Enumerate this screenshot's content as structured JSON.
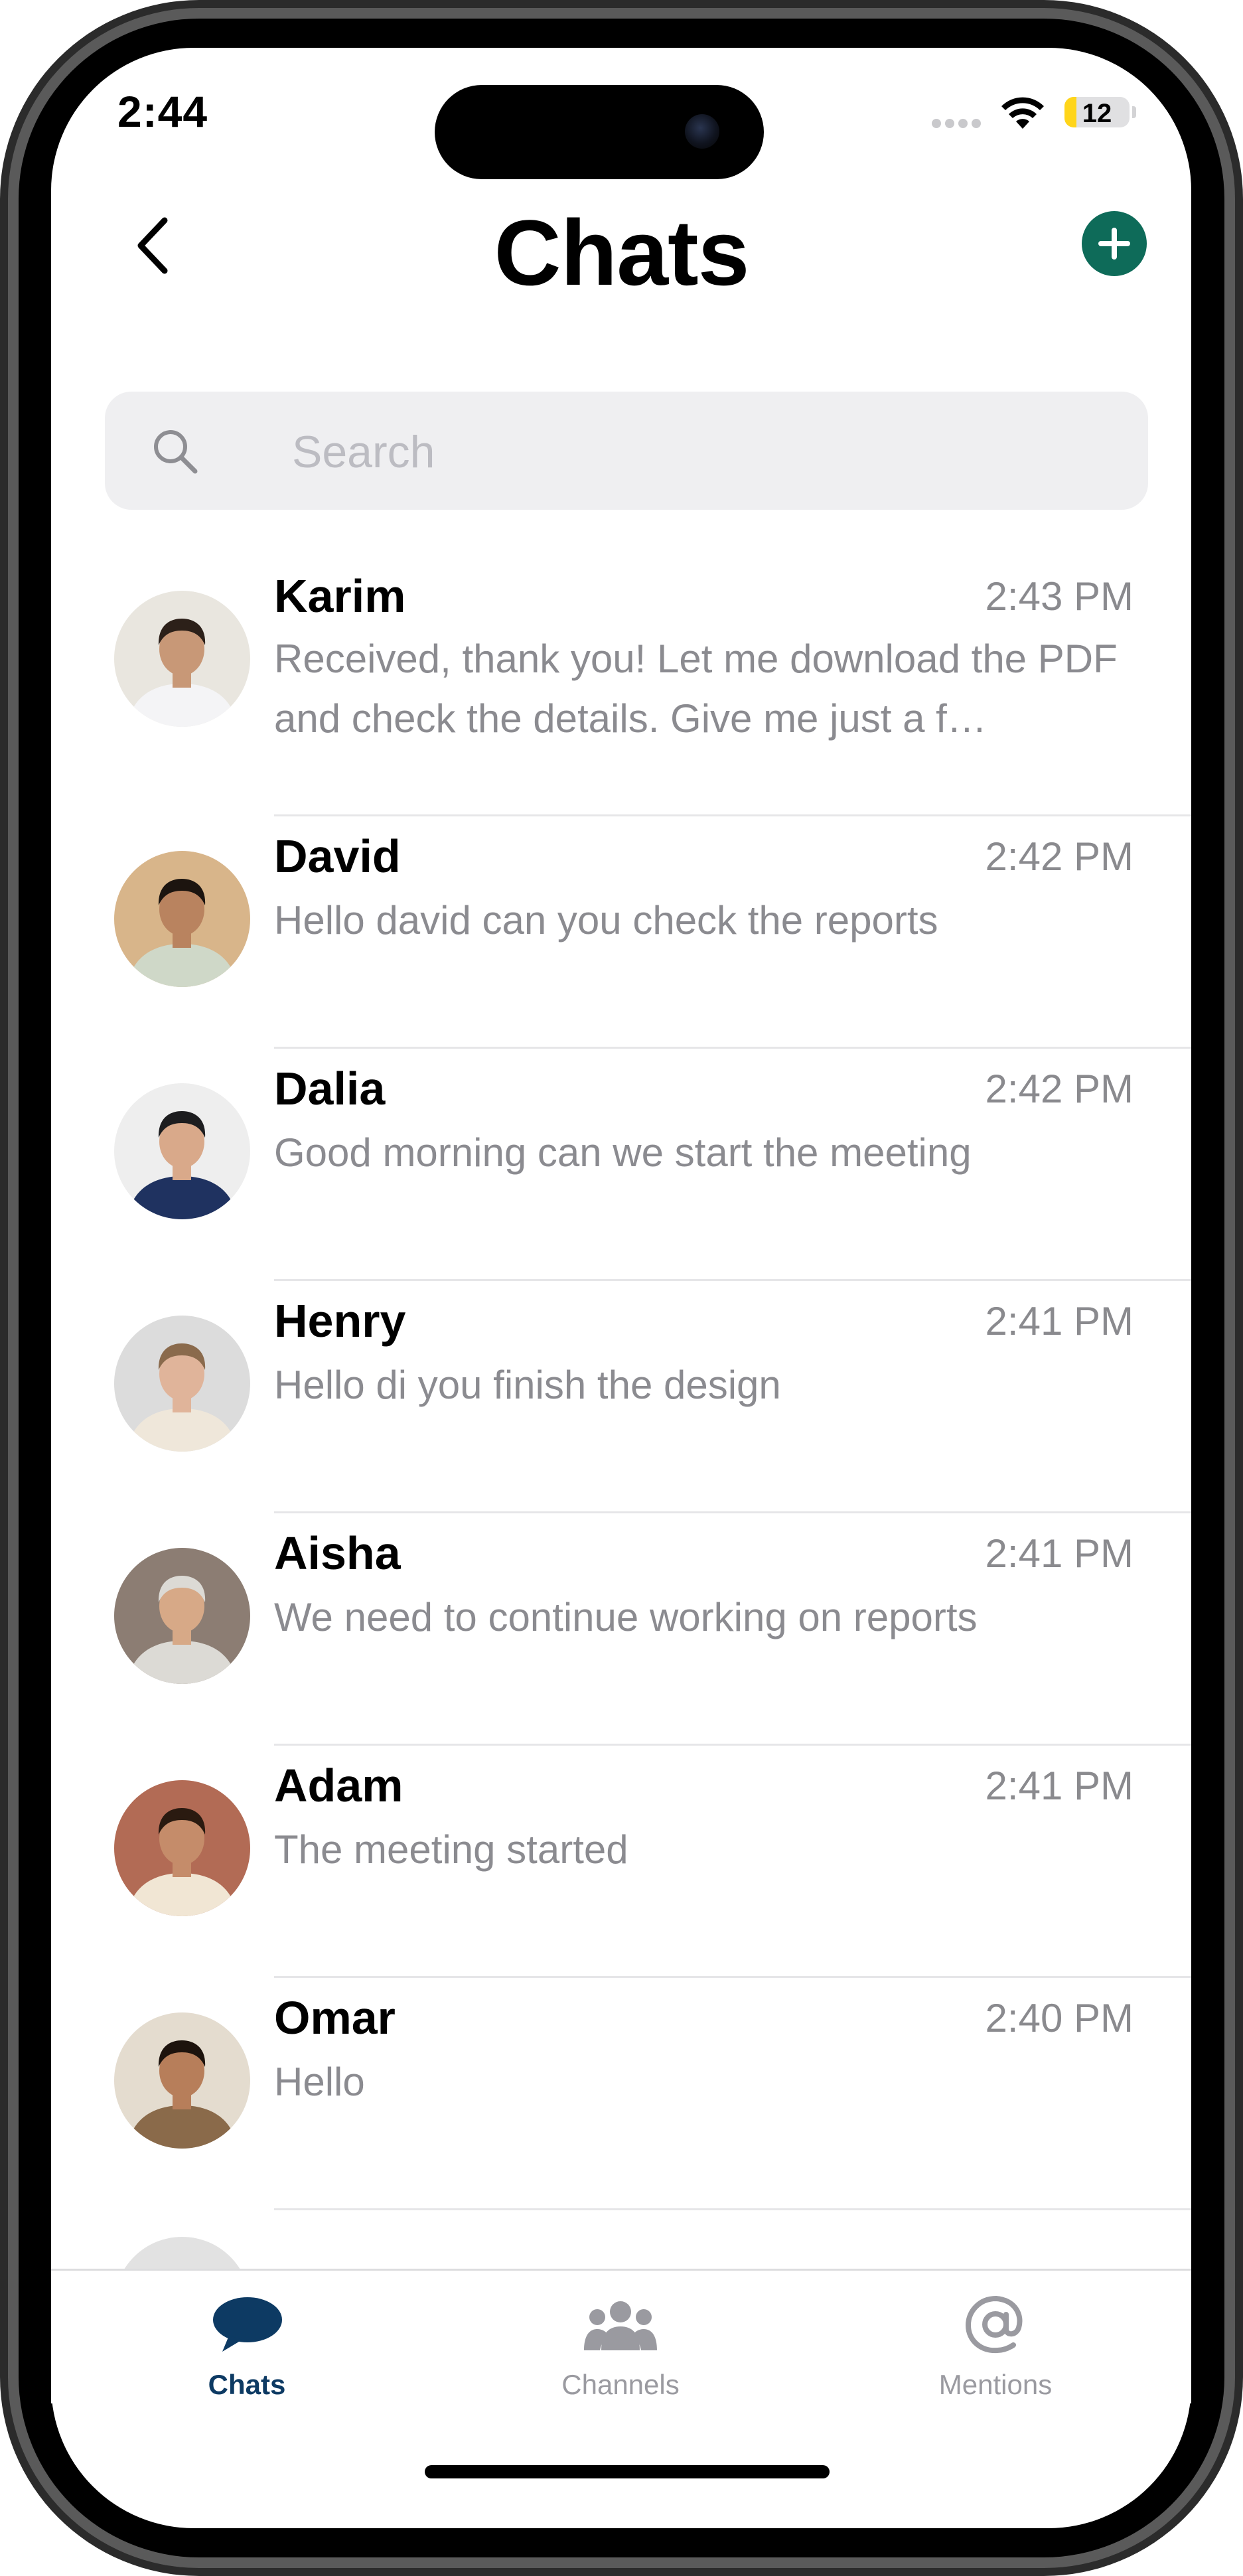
{
  "status_bar": {
    "time": "2:44",
    "battery": "12"
  },
  "header": {
    "title": "Chats"
  },
  "search": {
    "placeholder": "Search"
  },
  "chats": [
    {
      "name": "Karim",
      "time": "2:43 PM",
      "preview": "Received, thank you! Let me download the PDF and check the details. Give me just a f…",
      "avatar_bg": "#e9e6df",
      "skin": "#c89877",
      "shirt": "#f4f4f6",
      "hair": "#2c2019"
    },
    {
      "name": "David",
      "time": "2:42 PM",
      "preview": "Hello david can you check the reports",
      "avatar_bg": "#d8b58a",
      "skin": "#b9835f",
      "shirt": "#cfd8c8",
      "hair": "#1c140f"
    },
    {
      "name": "Dalia",
      "time": "2:42 PM",
      "preview": "Good morning can we start the meeting",
      "avatar_bg": "#eeeeee",
      "skin": "#d9a98a",
      "shirt": "#1f3260",
      "hair": "#1d1d1f"
    },
    {
      "name": "Henry",
      "time": "2:41 PM",
      "preview": "Hello di you finish the design",
      "avatar_bg": "#dcdcdc",
      "skin": "#e0b49a",
      "shirt": "#efe7da",
      "hair": "#8a6a4c"
    },
    {
      "name": "Aisha",
      "time": "2:41 PM",
      "preview": "We need to continue working on reports",
      "avatar_bg": "#8c7d73",
      "skin": "#d7a987",
      "shirt": "#dcdad5",
      "hair": "#dcdad5"
    },
    {
      "name": "Adam",
      "time": "2:41 PM",
      "preview": "The meeting started",
      "avatar_bg": "#b26b55",
      "skin": "#c58c6a",
      "shirt": "#f1e6d4",
      "hair": "#2a1a10"
    },
    {
      "name": "Omar",
      "time": "2:40 PM",
      "preview": "Hello",
      "avatar_bg": "#e4dccf",
      "skin": "#b77e5a",
      "shirt": "#8a6a4a",
      "hair": "#1d130d"
    }
  ],
  "tabs": [
    {
      "label": "Chats",
      "icon": "chat-bubble-icon",
      "active": true
    },
    {
      "label": "Channels",
      "icon": "people-group-icon",
      "active": false
    },
    {
      "label": "Mentions",
      "icon": "at-sign-icon",
      "active": false
    }
  ],
  "colors": {
    "accent": "#0e6b59",
    "tab_active": "#0d3a63",
    "tab_inactive": "#9a9aa0"
  }
}
